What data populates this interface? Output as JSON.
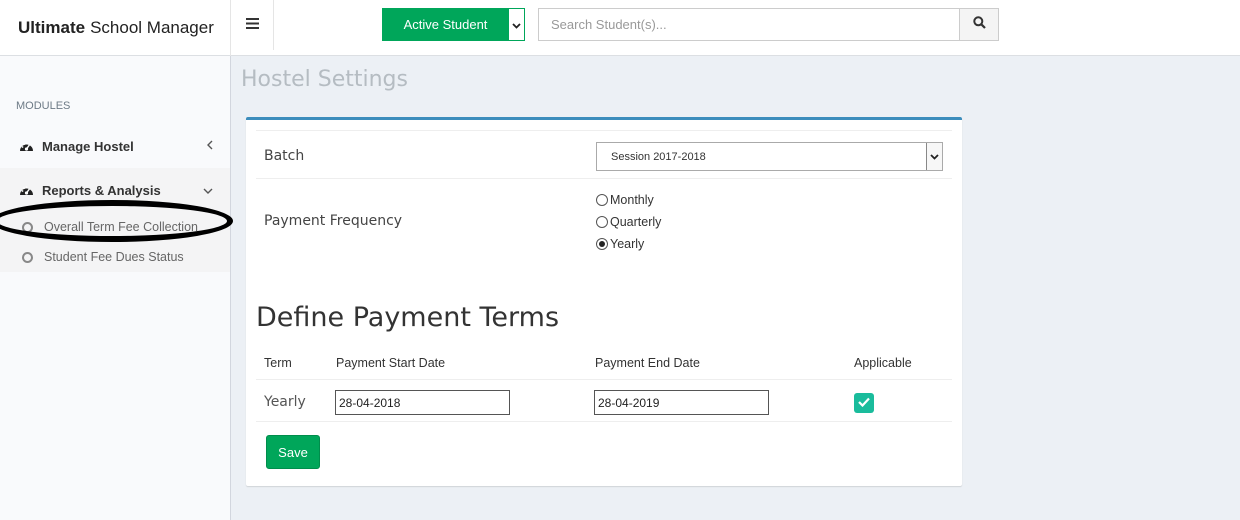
{
  "header": {
    "brand_bold": "Ultimate",
    "brand_rest": "School Manager",
    "active_student_label": "Active Student",
    "search_placeholder": "Search Student(s)..."
  },
  "sidebar": {
    "section_label": "MODULES",
    "items": [
      {
        "label": "Manage Hostel",
        "arrow": "‹"
      },
      {
        "label": "Reports & Analysis",
        "arrow": "⌄"
      }
    ],
    "subitems": [
      {
        "label": "Overall Term Fee Collection"
      },
      {
        "label": "Student Fee Dues Status"
      }
    ]
  },
  "page": {
    "title": "Hostel Settings",
    "batch_label": "Batch",
    "batch_value": "Session 2017-2018",
    "frequency_label": "Payment Frequency",
    "frequency_options": [
      "Monthly",
      "Quarterly",
      "Yearly"
    ],
    "frequency_selected": "Yearly",
    "section_title": "Define Payment Terms",
    "table": {
      "headers": [
        "Term",
        "Payment Start Date",
        "Payment End Date",
        "Applicable"
      ],
      "rows": [
        {
          "term": "Yearly",
          "start": "28-04-2018",
          "end": "28-04-2019",
          "applicable": true
        }
      ]
    },
    "save_label": "Save"
  },
  "colors": {
    "primary_green": "#00a65a",
    "box_accent": "#3c8dbc",
    "checkbox_teal": "#1abc9c"
  }
}
